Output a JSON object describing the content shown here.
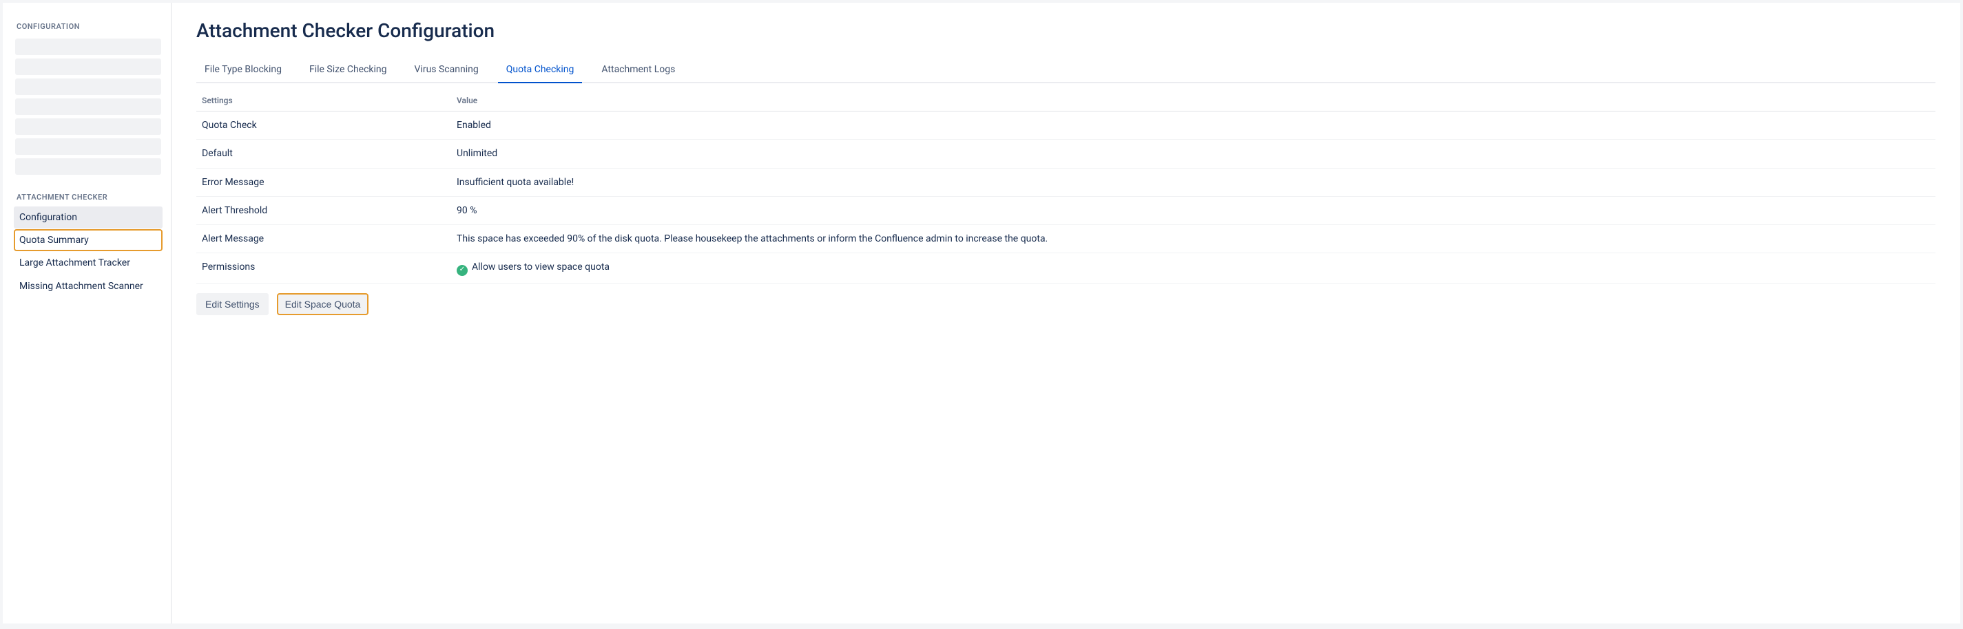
{
  "sidebar": {
    "section1_label": "CONFIGURATION",
    "section2_label": "ATTACHMENT CHECKER",
    "items": [
      {
        "label": "Configuration"
      },
      {
        "label": "Quota Summary"
      },
      {
        "label": "Large Attachment Tracker"
      },
      {
        "label": "Missing Attachment Scanner"
      }
    ]
  },
  "page": {
    "title": "Attachment Checker Configuration"
  },
  "tabs": [
    {
      "label": "File Type Blocking"
    },
    {
      "label": "File Size Checking"
    },
    {
      "label": "Virus Scanning"
    },
    {
      "label": "Quota Checking"
    },
    {
      "label": "Attachment Logs"
    }
  ],
  "table": {
    "header_settings": "Settings",
    "header_value": "Value",
    "rows": [
      {
        "k": "Quota Check",
        "v": "Enabled"
      },
      {
        "k": "Default",
        "v": "Unlimited"
      },
      {
        "k": "Error Message",
        "v": "Insufficient quota available!"
      },
      {
        "k": "Alert Threshold",
        "v": "90 %"
      },
      {
        "k": "Alert Message",
        "v": "This space has exceeded 90% of the disk quota. Please housekeep the attachments or inform the Confluence admin to increase the quota."
      },
      {
        "k": "Permissions",
        "v": "Allow users to view space quota"
      }
    ]
  },
  "buttons": {
    "edit_settings": "Edit Settings",
    "edit_space_quota": "Edit Space Quota"
  }
}
